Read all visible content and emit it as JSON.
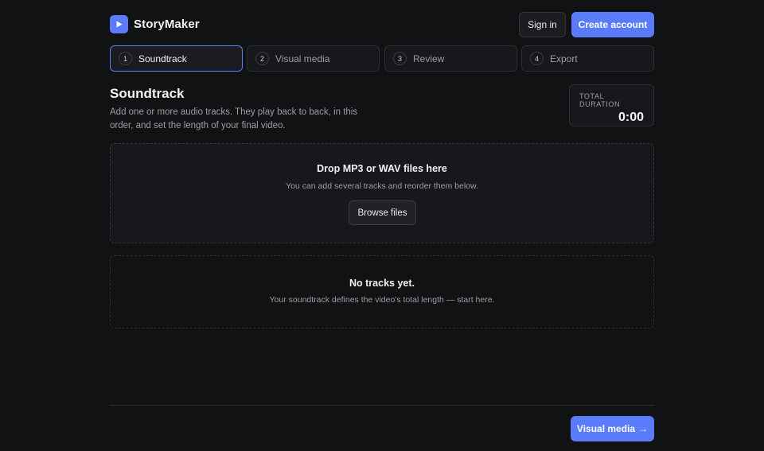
{
  "app": {
    "name": "StoryMaker",
    "logo_icon": "play-icon",
    "accent_color": "#5b7cfa"
  },
  "header": {
    "sign_in_label": "Sign in",
    "create_account_label": "Create account"
  },
  "steps": [
    {
      "number": "1",
      "label": "Soundtrack",
      "active": true
    },
    {
      "number": "2",
      "label": "Visual media",
      "active": false
    },
    {
      "number": "3",
      "label": "Review",
      "active": false
    },
    {
      "number": "4",
      "label": "Export",
      "active": false
    }
  ],
  "section": {
    "title": "Soundtrack",
    "description": "Add one or more audio tracks. They play back to back, in this order, and set the length of your final video."
  },
  "duration": {
    "label": "TOTAL DURATION",
    "value": "0:00"
  },
  "dropzone": {
    "title": "Drop MP3 or WAV files here",
    "subtitle": "You can add several tracks and reorder them below.",
    "browse_label": "Browse files"
  },
  "empty_state": {
    "title": "No tracks yet.",
    "subtitle": "Your soundtrack defines the video's total length — start here."
  },
  "footer": {
    "next_label": "Visual media",
    "next_arrow": "→"
  }
}
